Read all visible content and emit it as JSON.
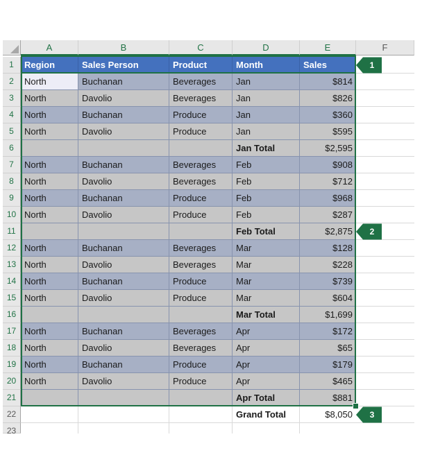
{
  "sheet": {
    "name": "excel-subtotal-worksheet",
    "columns": [
      {
        "letter": "A",
        "selected": true
      },
      {
        "letter": "B",
        "selected": true
      },
      {
        "letter": "C",
        "selected": true
      },
      {
        "letter": "D",
        "selected": true
      },
      {
        "letter": "E",
        "selected": true
      },
      {
        "letter": "F",
        "selected": false
      }
    ],
    "row_headers": [
      {
        "n": "1",
        "selected": true
      },
      {
        "n": "2",
        "selected": true
      },
      {
        "n": "3",
        "selected": true
      },
      {
        "n": "4",
        "selected": true
      },
      {
        "n": "5",
        "selected": true
      },
      {
        "n": "6",
        "selected": true
      },
      {
        "n": "7",
        "selected": true
      },
      {
        "n": "8",
        "selected": true
      },
      {
        "n": "9",
        "selected": true
      },
      {
        "n": "10",
        "selected": true
      },
      {
        "n": "11",
        "selected": true
      },
      {
        "n": "12",
        "selected": true
      },
      {
        "n": "13",
        "selected": true
      },
      {
        "n": "14",
        "selected": true
      },
      {
        "n": "15",
        "selected": true
      },
      {
        "n": "16",
        "selected": true
      },
      {
        "n": "17",
        "selected": true
      },
      {
        "n": "18",
        "selected": true
      },
      {
        "n": "19",
        "selected": true
      },
      {
        "n": "20",
        "selected": true
      },
      {
        "n": "21",
        "selected": true
      },
      {
        "n": "22",
        "selected": false
      },
      {
        "n": "23",
        "selected": false
      }
    ],
    "header_row": {
      "row": 1,
      "cells": [
        "Region",
        "Sales Person",
        "Product",
        "Month",
        "Sales"
      ]
    },
    "rows": [
      {
        "n": 2,
        "band": "blue",
        "total": false,
        "cells": [
          "North",
          "Buchanan",
          "Beverages",
          "Jan",
          "$814"
        ]
      },
      {
        "n": 3,
        "band": "gray",
        "total": false,
        "cells": [
          "North",
          "Davolio",
          "Beverages",
          "Jan",
          "$826"
        ]
      },
      {
        "n": 4,
        "band": "blue",
        "total": false,
        "cells": [
          "North",
          "Buchanan",
          "Produce",
          "Jan",
          "$360"
        ]
      },
      {
        "n": 5,
        "band": "gray",
        "total": false,
        "cells": [
          "North",
          "Davolio",
          "Produce",
          "Jan",
          "$595"
        ]
      },
      {
        "n": 6,
        "band": "gray",
        "total": true,
        "cells": [
          "",
          "",
          "",
          "Jan Total",
          "$2,595"
        ]
      },
      {
        "n": 7,
        "band": "blue",
        "total": false,
        "cells": [
          "North",
          "Buchanan",
          "Beverages",
          "Feb",
          "$908"
        ]
      },
      {
        "n": 8,
        "band": "gray",
        "total": false,
        "cells": [
          "North",
          "Davolio",
          "Beverages",
          "Feb",
          "$712"
        ]
      },
      {
        "n": 9,
        "band": "blue",
        "total": false,
        "cells": [
          "North",
          "Buchanan",
          "Produce",
          "Feb",
          "$968"
        ]
      },
      {
        "n": 10,
        "band": "gray",
        "total": false,
        "cells": [
          "North",
          "Davolio",
          "Produce",
          "Feb",
          "$287"
        ]
      },
      {
        "n": 11,
        "band": "gray",
        "total": true,
        "cells": [
          "",
          "",
          "",
          "Feb Total",
          "$2,875"
        ]
      },
      {
        "n": 12,
        "band": "blue",
        "total": false,
        "cells": [
          "North",
          "Buchanan",
          "Beverages",
          "Mar",
          "$128"
        ]
      },
      {
        "n": 13,
        "band": "gray",
        "total": false,
        "cells": [
          "North",
          "Davolio",
          "Beverages",
          "Mar",
          "$228"
        ]
      },
      {
        "n": 14,
        "band": "blue",
        "total": false,
        "cells": [
          "North",
          "Buchanan",
          "Produce",
          "Mar",
          "$739"
        ]
      },
      {
        "n": 15,
        "band": "gray",
        "total": false,
        "cells": [
          "North",
          "Davolio",
          "Produce",
          "Mar",
          "$604"
        ]
      },
      {
        "n": 16,
        "band": "gray",
        "total": true,
        "cells": [
          "",
          "",
          "",
          "Mar Total",
          "$1,699"
        ]
      },
      {
        "n": 17,
        "band": "blue",
        "total": false,
        "cells": [
          "North",
          "Buchanan",
          "Beverages",
          "Apr",
          "$172"
        ]
      },
      {
        "n": 18,
        "band": "gray",
        "total": false,
        "cells": [
          "North",
          "Davolio",
          "Beverages",
          "Apr",
          "$65"
        ]
      },
      {
        "n": 19,
        "band": "blue",
        "total": false,
        "cells": [
          "North",
          "Buchanan",
          "Produce",
          "Apr",
          "$179"
        ]
      },
      {
        "n": 20,
        "band": "gray",
        "total": false,
        "cells": [
          "North",
          "Davolio",
          "Produce",
          "Apr",
          "$465"
        ]
      },
      {
        "n": 21,
        "band": "gray",
        "total": true,
        "cells": [
          "",
          "",
          "",
          "Apr Total",
          "$881"
        ]
      },
      {
        "n": 22,
        "band": "white",
        "total": true,
        "cells": [
          "",
          "",
          "",
          "Grand Total",
          "$8,050"
        ]
      },
      {
        "n": 23,
        "band": "white",
        "total": false,
        "cells": [
          "",
          "",
          "",
          "",
          ""
        ]
      }
    ],
    "active_cell": "A2",
    "selection_range": "A1:E21",
    "badges": [
      {
        "label": "1",
        "row": 1
      },
      {
        "label": "2",
        "row": 11
      },
      {
        "label": "3",
        "row": 22
      }
    ],
    "colors": {
      "selection_green": "#1F7145",
      "header_blue": "#4471BE",
      "band_blue": "#A7B0C5",
      "band_gray": "#C6C6C6",
      "active_cell_fill": "#EDEDF7",
      "selection_gridline": "#8793AE",
      "outside_gridline": "#D9D9D9",
      "header_strip_bg": "#E7E7E7",
      "header_text_selected": "#217346"
    }
  }
}
